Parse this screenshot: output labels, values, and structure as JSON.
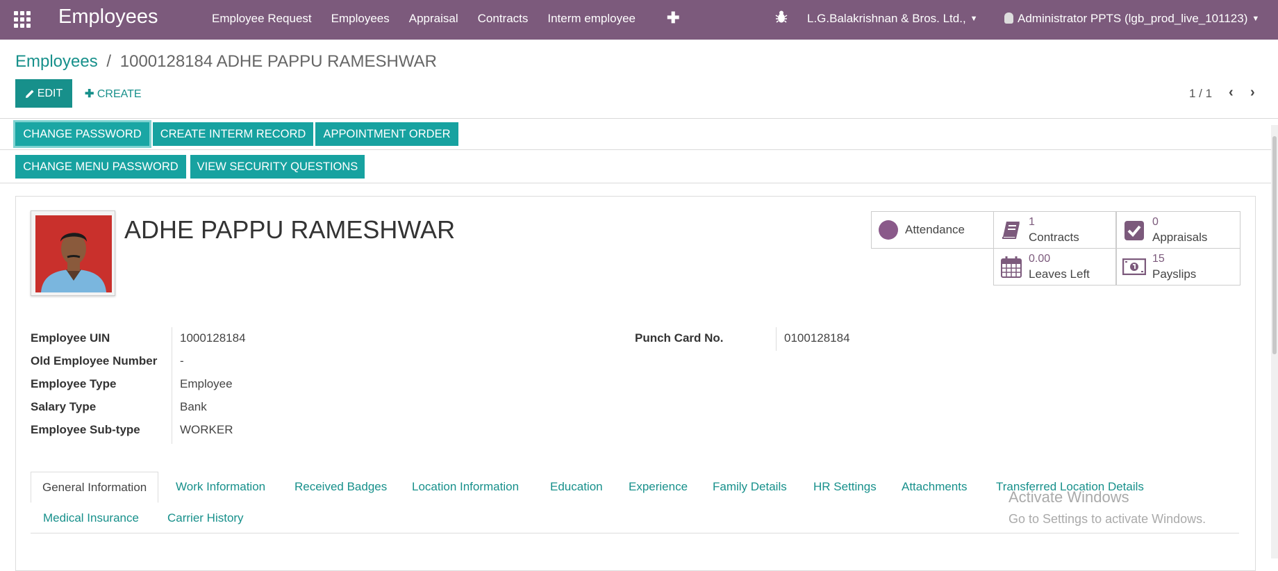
{
  "topbar": {
    "app_title": "Employees",
    "menu": [
      "Employee Request",
      "Employees",
      "Appraisal",
      "Contracts",
      "Interm employee"
    ],
    "plus": "✚",
    "company": "L.G.Balakrishnan & Bros. Ltd.,",
    "user": "Administrator PPTS (lgb_prod_live_101123)"
  },
  "breadcrumb": {
    "parent": "Employees",
    "sep": "/",
    "current": "1000128184 ADHE PAPPU RAMESHWAR"
  },
  "control": {
    "edit": "EDIT",
    "create": "CREATE",
    "pager": "1 / 1"
  },
  "actions": {
    "change_password": "CHANGE PASSWORD",
    "create_interm": "CREATE INTERM RECORD",
    "appointment": "APPOINTMENT ORDER",
    "change_menu_password": "CHANGE MENU PASSWORD",
    "security_questions": "VIEW SECURITY QUESTIONS"
  },
  "employee": {
    "name": "ADHE PAPPU RAMESHWAR"
  },
  "stats": {
    "attendance": "Attendance",
    "contracts_count": "1",
    "contracts": "Contracts",
    "appraisals_count": "0",
    "appraisals": "Appraisals",
    "leaves_count": "0.00",
    "leaves": "Leaves Left",
    "payslips_count": "15",
    "payslips": "Payslips"
  },
  "fields": {
    "uin_label": "Employee UIN",
    "uin": "1000128184",
    "old_label": "Old Employee Number",
    "old": "-",
    "type_label": "Employee Type",
    "type": "Employee",
    "salary_label": "Salary Type",
    "salary": "Bank",
    "subtype_label": "Employee Sub-type",
    "subtype": "WORKER",
    "punch_label": "Punch Card No.",
    "punch": "0100128184"
  },
  "tabs": [
    "General Information",
    "Work Information",
    "Received Badges",
    "Location Information",
    "Education",
    "Experience",
    "Family Details",
    "HR Settings",
    "Attachments",
    "Transferred Location Details",
    "Medical Insurance",
    "Carrier History"
  ],
  "watermark": {
    "title": "Activate Windows",
    "subtitle": "Go to Settings to activate Windows."
  },
  "colors": {
    "brand": "#7c5a7c",
    "accent": "#17908b",
    "button": "#17a2a0"
  }
}
